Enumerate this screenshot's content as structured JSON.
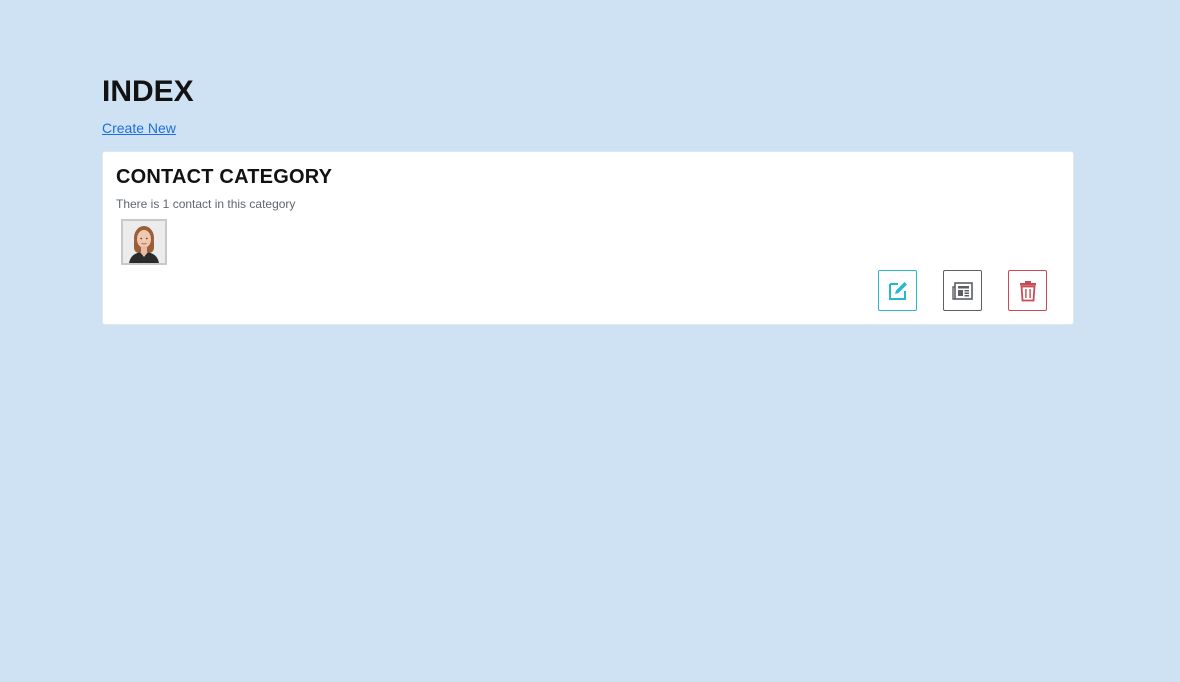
{
  "page": {
    "title": "INDEX",
    "create_link": "Create New"
  },
  "category_card": {
    "title": "CONTACT CATEGORY",
    "subtitle": "There is 1 contact in this category",
    "contacts": [
      {
        "avatar": "woman-portrait"
      }
    ],
    "actions": {
      "edit_icon": "edit-icon",
      "details_icon": "newspaper-icon",
      "delete_icon": "trash-icon"
    }
  },
  "colors": {
    "background": "#cfe2f3",
    "link": "#1e6fd9",
    "edit_accent": "#27b7cf",
    "details_accent": "#5c5f63",
    "delete_accent": "#c94a55"
  }
}
